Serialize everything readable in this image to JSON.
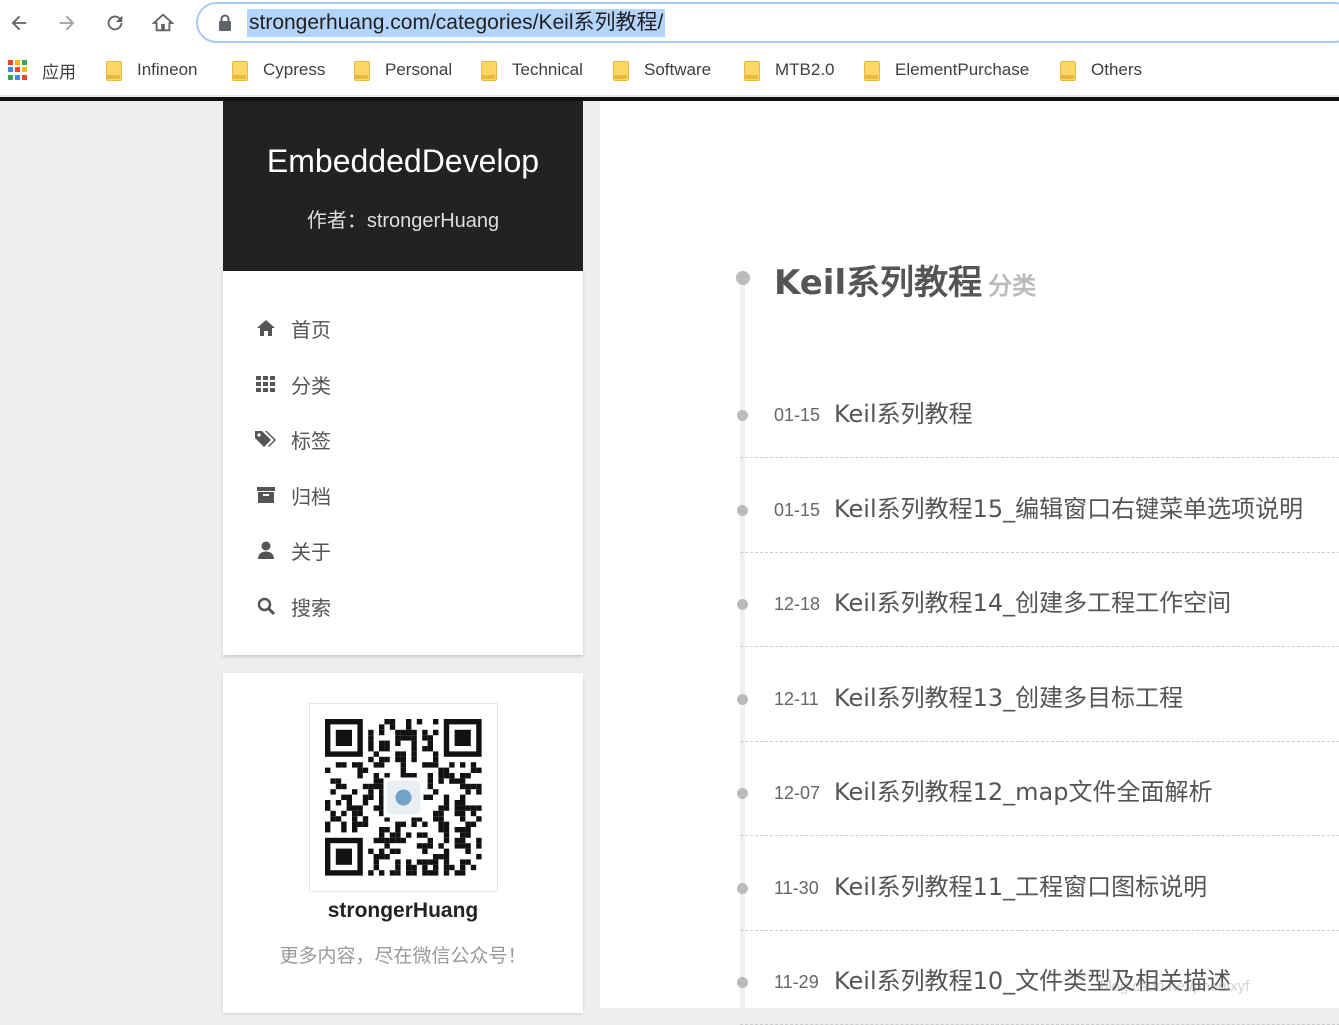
{
  "browser": {
    "url": "strongerhuang.com/categories/Keil系列教程/",
    "icons": [
      "back-arrow-icon",
      "forward-arrow-icon",
      "reload-icon",
      "home-icon",
      "lock-icon"
    ],
    "apps_label": "应用",
    "bookmarks": [
      {
        "label": "Infineon"
      },
      {
        "label": "Cypress"
      },
      {
        "label": "Personal"
      },
      {
        "label": "Technical"
      },
      {
        "label": "Software"
      },
      {
        "label": "MTB2.0"
      },
      {
        "label": "ElementPurchase"
      },
      {
        "label": "Others"
      }
    ],
    "apps_colors": [
      "#ea4335",
      "#fbbc05",
      "#34a853",
      "#4285f4",
      "#ea4335",
      "#fbbc05",
      "#34a853",
      "#4285f4",
      "#ea4335"
    ]
  },
  "site": {
    "title": "EmbeddedDevelop",
    "author": "作者：strongerHuang"
  },
  "menu": {
    "items": [
      {
        "label": "首页",
        "icon": "home-icon"
      },
      {
        "label": "分类",
        "icon": "grid-icon"
      },
      {
        "label": "标签",
        "icon": "tags-icon"
      },
      {
        "label": "归档",
        "icon": "archive-icon"
      },
      {
        "label": "关于",
        "icon": "user-icon"
      },
      {
        "label": "搜索",
        "icon": "search-icon"
      }
    ]
  },
  "qr": {
    "name": "strongerHuang",
    "desc": "更多内容，尽在微信公众号！"
  },
  "category": {
    "title": "Keil系列教程",
    "suffix": "分类",
    "posts": [
      {
        "date": "01-15",
        "title": "Keil系列教程"
      },
      {
        "date": "01-15",
        "title": "Keil系列教程15_编辑窗口右键菜单选项说明"
      },
      {
        "date": "12-18",
        "title": "Keil系列教程14_创建多工程工作空间"
      },
      {
        "date": "12-11",
        "title": "Keil系列教程13_创建多目标工程"
      },
      {
        "date": "12-07",
        "title": "Keil系列教程12_map文件全面解析"
      },
      {
        "date": "11-30",
        "title": "Keil系列教程11_工程窗口图标说明"
      },
      {
        "date": "11-29",
        "title": "Keil系列教程10_文件类型及相关描述"
      }
    ]
  },
  "watermark": "blog.csdn.net/phenixyf",
  "colors": {
    "header_bg": "#222222",
    "accent_highlight": "#b3d4fc",
    "folder": "#fcd666"
  }
}
